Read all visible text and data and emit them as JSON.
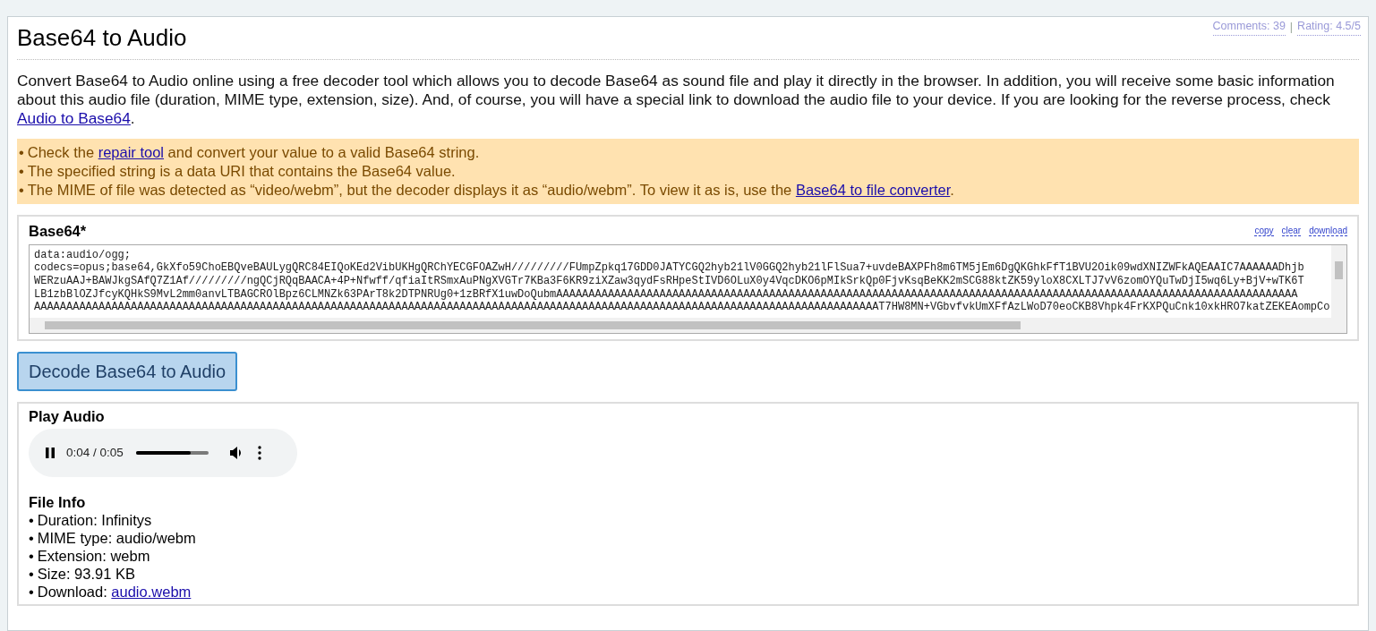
{
  "header": {
    "comments": "Comments: 39",
    "separator": "|",
    "rating": "Rating: 4.5/5"
  },
  "title": "Base64 to Audio",
  "intro": {
    "text": "Convert Base64 to Audio online using a free decoder tool which allows you to decode Base64 as sound file and play it directly in the browser. In addition, you will receive some basic information about this audio file (duration, MIME type, extension, size). And, of course, you will have a special link to download the audio file to your device. If you are looking for the reverse process, check ",
    "link": "Audio to Base64",
    "after": "."
  },
  "notices": [
    {
      "bullet": "•",
      "before": "Check the ",
      "link": "repair tool",
      "after": " and convert your value to a valid Base64 string."
    },
    {
      "bullet": "•",
      "before": "The specified string is a data URI that contains the Base64 value."
    },
    {
      "bullet": "•",
      "before": "The MIME of file was detected as “video/webm”, but the decoder displays it as “audio/webm”. To view it as is, use the ",
      "link": "Base64 to file converter",
      "after": "."
    }
  ],
  "input": {
    "label": "Base64*",
    "actions": [
      "copy",
      "clear",
      "download"
    ],
    "lines": [
      "data:audio/ogg;",
      "codecs=opus;base64,GkXfo59ChoEBQveBAULygQRC84EIQoKEd2VibUKHgQRChYECGFOAZwH/////////FUmpZpkq17GDD0JATYCGQ2hyb21lV0GGQ2hyb21lFlSua7+uvdeBAXPFh8m6TM5jEm6DgQKGhkFfT1BVU2Oik09wdXNIZWFkAQEAAIC7AAAAAADhjb",
      "WERzuAAJ+BAWJkgSAfQ7Z1Af/////////ngQCjRQqBAACA+4P+Nfwff/qfiaItRSmxAuPNgXVGTr7KBa3F6KR9ziXZaw3qydFsRHpeStIVD6OLuX0y4VqcDKO6pMIkSrkQp0FjvKsqBeKK2mSCG88ktZK59yloX8CXLTJ7vV6zomOYQuTwDjI5wq6Ly+BjV+wTK6T",
      "LB1zbBlOZJfcyKQHkS9MvL2mm0anvLTBAGCROlBpz6CLMNZk63PArT8k2DTPNRUg0+1zBRfX1uwDoQubmAAAAAAAAAAAAAAAAAAAAAAAAAAAAAAAAAAAAAAAAAAAAAAAAAAAAAAAAAAAAAAAAAAAAAAAAAAAAAAAAAAAAAAAAAAAAAAAAAAAAAAAAAAAAAAAAAAA",
      "AAAAAAAAAAAAAAAAAAAAAAAAAAAAAAAAAAAAAAAAAAAAAAAAAAAAAAAAAAAAAAAAAAAAAAAAAAAAAAAAAAAAAAAAAAAAAAAAAAAAAAAAAAAAAAAAAAAAAAAAAAAAAAAAAAAT7HW8MN+VGbvfvkUmXFfAzLWoD70eoCKB8Vhpk4FrKXPQuCnk10xkHRO7katZEKEAompCo"
    ]
  },
  "decode_button": "Decode Base64 to Audio",
  "player_section": {
    "title": "Play Audio",
    "player": {
      "playing": true,
      "time": "0:04 / 0:05",
      "level": 0.75
    }
  },
  "file_info": {
    "title": "File Info",
    "items": [
      {
        "bullet": "•",
        "text": "Duration: Infinitys"
      },
      {
        "bullet": "•",
        "text": "MIME type: audio/webm"
      },
      {
        "bullet": "•",
        "text": "Extension: webm"
      },
      {
        "bullet": "•",
        "text": "Size: 93.91 KB"
      },
      {
        "bullet": "•",
        "text": "Download: ",
        "link": "audio.webm"
      }
    ]
  }
}
